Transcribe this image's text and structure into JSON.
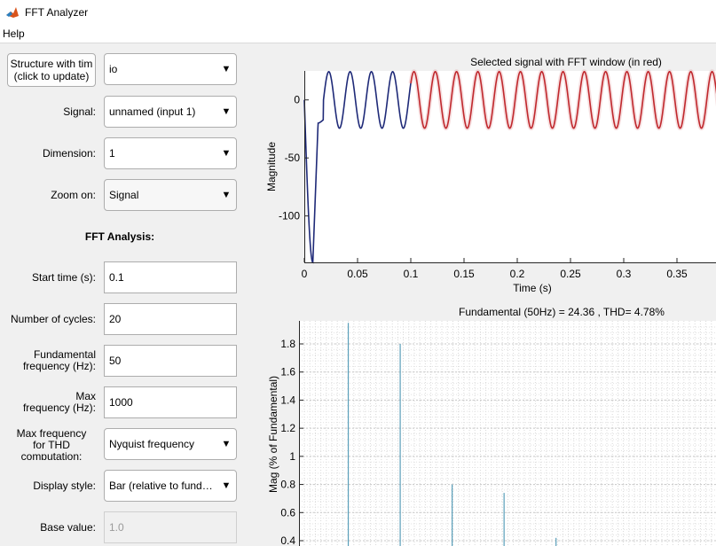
{
  "window": {
    "title": "FFT Analyzer"
  },
  "menu": {
    "items": [
      "Help"
    ]
  },
  "controls": {
    "structure_button": [
      "Structure with tim",
      "(click to update)"
    ],
    "structure_value": "io",
    "signal_label": "Signal:",
    "signal_value": "unnamed (input 1)",
    "dimension_label": "Dimension:",
    "dimension_value": "1",
    "zoom_label": "Zoom on:",
    "zoom_value": "Signal",
    "fft_title": "FFT Analysis:",
    "start_time_label": "Start time (s):",
    "start_time_value": "0.1",
    "cycles_label": "Number of cycles:",
    "cycles_value": "20",
    "fundamental_label": [
      "Fundamental",
      "frequency (Hz):"
    ],
    "fundamental_value": "50",
    "max_freq_label": [
      "Max",
      "frequency (Hz):"
    ],
    "max_freq_value": "1000",
    "thd_label": [
      "Max frequency",
      "for THD",
      "computation:"
    ],
    "thd_value": "Nyquist frequency",
    "display_label": "Display style:",
    "display_value": "Bar (relative to fund…",
    "base_label": "Base value:",
    "base_value": "1.0"
  },
  "colors": {
    "signal": "#1f2a78",
    "fft_window": "#c0282d",
    "spectrum_bar": "#5a9fba"
  },
  "chart_data": [
    {
      "type": "line",
      "title": "Selected signal with FFT window (in red)",
      "xlabel": "Time (s)",
      "ylabel": "Magnitude",
      "xlim": [
        0,
        0.4
      ],
      "ylim": [
        -140,
        25
      ],
      "xticks": [
        0,
        0.05,
        0.1,
        0.15,
        0.2,
        0.25,
        0.3,
        0.35
      ],
      "xtick_labels": [
        "0",
        "0.05",
        "0.1",
        "0.15",
        "0.2",
        "0.25",
        "0.3",
        "0.35"
      ],
      "yticks": [
        0,
        -50,
        -100
      ],
      "ytick_labels": [
        "0",
        "-50",
        "-100"
      ],
      "series": [
        {
          "frequency_hz": 50,
          "amplitude": 24.36,
          "time_range": [
            0,
            0.1
          ],
          "initial_transient_min": -140
        },
        {
          "frequency_hz": 50,
          "amplitude": 24.36,
          "time_range": [
            0.1,
            0.4
          ]
        }
      ]
    },
    {
      "type": "bar",
      "title": "Fundamental (50Hz) = 24.36 , THD= 4.78%",
      "ylabel": "Mag (% of Fundamental)",
      "xlim": [
        0,
        820
      ],
      "ylim": [
        0.4,
        1.95
      ],
      "yticks": [
        0.4,
        0.6,
        0.8,
        1,
        1.2,
        1.4,
        1.6,
        1.8
      ],
      "ytick_labels": [
        "0.4",
        "0.6",
        "0.8",
        "1",
        "1.2",
        "1.4",
        "1.6",
        "1.8"
      ],
      "grid": true,
      "x": [
        100,
        200,
        300,
        400,
        500
      ],
      "values": [
        1.95,
        1.8,
        0.8,
        0.74,
        0.42
      ]
    }
  ]
}
